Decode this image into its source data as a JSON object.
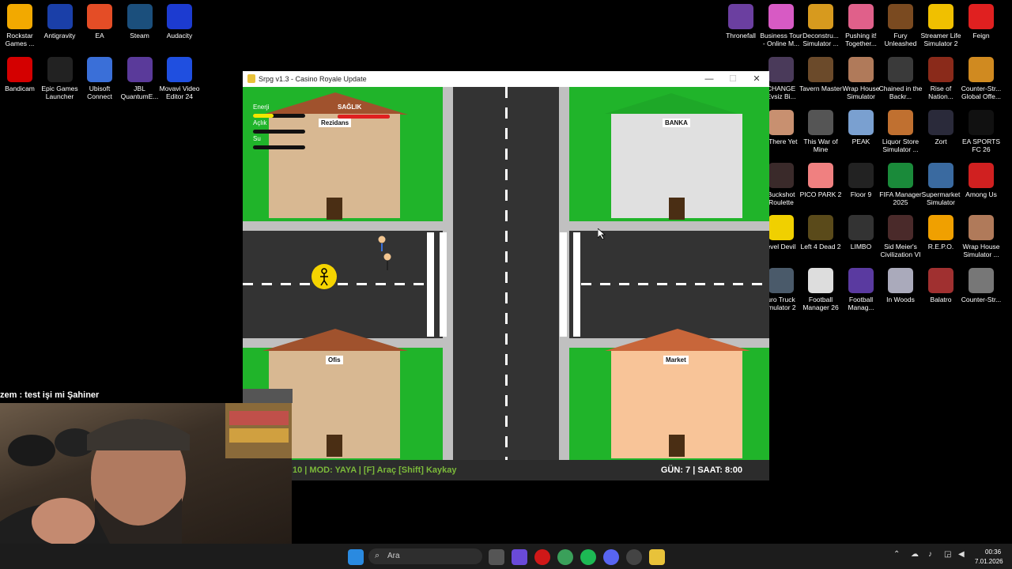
{
  "desktop_left": [
    {
      "label": "Rockstar Games ...",
      "icon": "rockstar-icon",
      "color": "#f2a900"
    },
    {
      "label": "Antigravity",
      "icon": "antigravity-icon",
      "color": "#1a3fa8"
    },
    {
      "label": "EA",
      "icon": "ea-icon",
      "color": "#e44d26"
    },
    {
      "label": "Steam",
      "icon": "steam-icon",
      "color": "#1b4f7c"
    },
    {
      "label": "Audacity",
      "icon": "audacity-icon",
      "color": "#1c3bd0"
    },
    {
      "label": "Bandicam",
      "icon": "bandicam-icon",
      "color": "#d40000"
    },
    {
      "label": "Epic Games Launcher",
      "icon": "epic-icon",
      "color": "#222"
    },
    {
      "label": "Ubisoft Connect",
      "icon": "ubisoft-icon",
      "color": "#3a6fd8"
    },
    {
      "label": "JBL QuantumE...",
      "icon": "jbl-icon",
      "color": "#5a3a9a"
    },
    {
      "label": "Movavi Video Editor 24",
      "icon": "movavi-icon",
      "color": "#1f4fe0"
    }
  ],
  "desktop_right": [
    {
      "label": "Thronefall",
      "icon": "thronefall-icon",
      "color": "#6b3fa0"
    },
    {
      "label": "Business Tour - Online M...",
      "icon": "business-tour-icon",
      "color": "#d75ac4"
    },
    {
      "label": "Deconstru... Simulator ...",
      "icon": "deconstruction-icon",
      "color": "#d79a1e"
    },
    {
      "label": "Pushing it! Together...",
      "icon": "pushing-icon",
      "color": "#e0608a"
    },
    {
      "label": "Fury Unleashed",
      "icon": "fury-icon",
      "color": "#7a4a20"
    },
    {
      "label": "Streamer Life Simulator 2",
      "icon": "streamer-life-icon",
      "color": "#f0c000"
    },
    {
      "label": "Feign",
      "icon": "feign-icon",
      "color": "#e02020"
    },
    {
      "label": "CHANGE Evsiz Bi...",
      "icon": "change-icon",
      "color": "#4a3a5a"
    },
    {
      "label": "Tavern Master",
      "icon": "tavern-icon",
      "color": "#6b4a2a"
    },
    {
      "label": "Wrap House Simulator",
      "icon": "wrap-house-icon",
      "color": "#b07a5a"
    },
    {
      "label": "Chained in the Backr...",
      "icon": "chained-icon",
      "color": "#3a3a3a"
    },
    {
      "label": "Rise of Nation...",
      "icon": "rise-icon",
      "color": "#8a2a1a"
    },
    {
      "label": "Counter-Str... Global Offe...",
      "icon": "csgo-icon",
      "color": "#d08a20"
    },
    {
      "label": "/ There Yet",
      "icon": "there-yet-icon",
      "color": "#c89070"
    },
    {
      "label": "This War of Mine",
      "icon": "war-of-mine-icon",
      "color": "#555"
    },
    {
      "label": "PEAK",
      "icon": "peak-icon",
      "color": "#7aa0d0"
    },
    {
      "label": "Liquor Store Simulator ...",
      "icon": "liquor-icon",
      "color": "#c07030"
    },
    {
      "label": "Zort",
      "icon": "zort-icon",
      "color": "#2a2a3a"
    },
    {
      "label": "EA SPORTS FC 26",
      "icon": "fc26-icon",
      "color": "#111"
    },
    {
      "label": "Buckshot Roulette",
      "icon": "buckshot-icon",
      "color": "#3a2a2a"
    },
    {
      "label": "PICO PARK 2",
      "icon": "pico-icon",
      "color": "#f08080"
    },
    {
      "label": "Floor 9",
      "icon": "floor9-icon",
      "color": "#222"
    },
    {
      "label": "FIFA Manager 2025",
      "icon": "fifa-manager-icon",
      "color": "#1a8a3a"
    },
    {
      "label": "Supermarket Simulator",
      "icon": "supermarket-icon",
      "color": "#3a6aa0"
    },
    {
      "label": "Among Us",
      "icon": "among-us-icon",
      "color": "#d02020"
    },
    {
      "label": "evel Devil",
      "icon": "level-devil-icon",
      "color": "#f0d000"
    },
    {
      "label": "Left 4 Dead 2",
      "icon": "l4d2-icon",
      "color": "#5a4a1a"
    },
    {
      "label": "LIMBO",
      "icon": "limbo-icon",
      "color": "#333"
    },
    {
      "label": "Sid Meier's Civilization VI",
      "icon": "civ-icon",
      "color": "#4a2a2a"
    },
    {
      "label": "R.E.P.O.",
      "icon": "repo-icon",
      "color": "#f0a000"
    },
    {
      "label": "Wrap House Simulator ...",
      "icon": "wrap-house2-icon",
      "color": "#b07a5a"
    },
    {
      "label": "uro Truck imulator 2",
      "icon": "ets2-icon",
      "color": "#4a5a6a"
    },
    {
      "label": "Football Manager 26",
      "icon": "fm26-icon",
      "color": "#ddd"
    },
    {
      "label": "Football Manag...",
      "icon": "fm-icon",
      "color": "#5a3aa0"
    },
    {
      "label": "In Woods",
      "icon": "in-woods-icon",
      "color": "#aab"
    },
    {
      "label": "Balatro",
      "icon": "balatro-icon",
      "color": "#a03030"
    },
    {
      "label": "Counter-Str...",
      "icon": "cs2-icon",
      "color": "#777"
    }
  ],
  "window": {
    "title": "Srpg v1.3 - Casino Royale Update",
    "minimize": "—",
    "maximize": "☐",
    "close": "✕"
  },
  "game": {
    "buildings": {
      "residence": "Rezidans",
      "bank": "BANKA",
      "office": "Ofis",
      "market": "Market"
    },
    "hud": {
      "energy_label": "Enerji",
      "hunger_label": "Açlık",
      "water_label": "Su",
      "health_label": "SAĞLIK",
      "energy": 0.4,
      "hunger": 0.0,
      "water": 0.0,
      "health": 1.0
    },
    "status_left": "10  |  MOD: YAYA  |  [F] Araç [Shift] Kaykay",
    "status_right": "GÜN: 7 | SAAT: 8:00"
  },
  "chat": {
    "line": "zem : test işi mi Şahiner"
  },
  "taskbar": {
    "search_placeholder": "Ara",
    "time": "00:36",
    "date": "7.01.2026"
  },
  "colors": {
    "grass": "#20b42a",
    "house_wall": "#d8b892",
    "bank_wall": "#e0e0e0",
    "market_wall": "#f8c498",
    "roof": "#a0522d",
    "road": "#333333"
  }
}
